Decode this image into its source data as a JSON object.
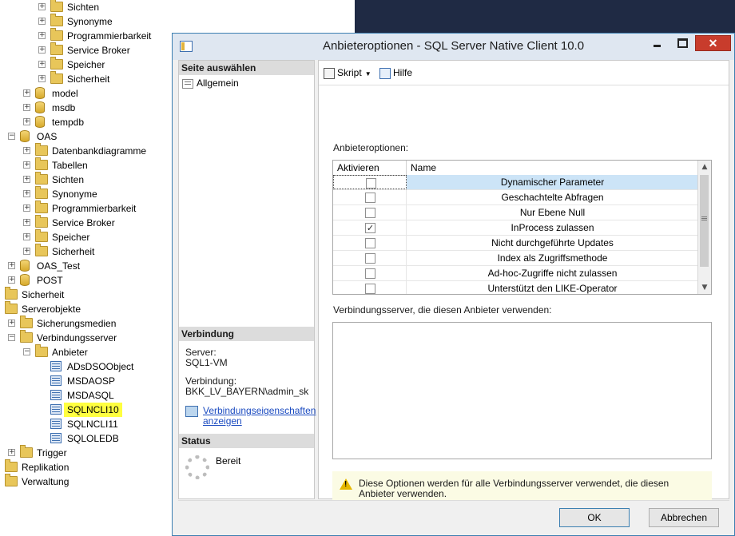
{
  "tree": {
    "items": [
      {
        "label": "Sichten",
        "icon": "folder-icon",
        "expander": "+"
      },
      {
        "label": "Synonyme",
        "icon": "folder-icon",
        "expander": "+"
      },
      {
        "label": "Programmierbarkeit",
        "icon": "folder-icon",
        "expander": "+"
      },
      {
        "label": "Service Broker",
        "icon": "folder-icon",
        "expander": "+"
      },
      {
        "label": "Speicher",
        "icon": "folder-icon",
        "expander": "+"
      },
      {
        "label": "Sicherheit",
        "icon": "folder-icon",
        "expander": "+"
      },
      {
        "label": "model",
        "icon": "database-icon",
        "expander": "+"
      },
      {
        "label": "msdb",
        "icon": "database-icon",
        "expander": "+"
      },
      {
        "label": "tempdb",
        "icon": "database-icon",
        "expander": "+"
      },
      {
        "label": "OAS",
        "icon": "database-icon",
        "expander": "−"
      },
      {
        "label": "Datenbankdiagramme",
        "icon": "folder-icon",
        "expander": "+"
      },
      {
        "label": "Tabellen",
        "icon": "folder-icon",
        "expander": "+"
      },
      {
        "label": "Sichten",
        "icon": "folder-icon",
        "expander": "+"
      },
      {
        "label": "Synonyme",
        "icon": "folder-icon",
        "expander": "+"
      },
      {
        "label": "Programmierbarkeit",
        "icon": "folder-icon",
        "expander": "+"
      },
      {
        "label": "Service Broker",
        "icon": "folder-icon",
        "expander": "+"
      },
      {
        "label": "Speicher",
        "icon": "folder-icon",
        "expander": "+"
      },
      {
        "label": "Sicherheit",
        "icon": "folder-icon",
        "expander": "+"
      },
      {
        "label": "OAS_Test",
        "icon": "database-icon",
        "expander": "+"
      },
      {
        "label": "POST",
        "icon": "database-icon",
        "expander": "+"
      },
      {
        "label": "Sicherheit",
        "icon": "folder-icon",
        "expander": ""
      },
      {
        "label": "Serverobjekte",
        "icon": "folder-icon",
        "expander": ""
      },
      {
        "label": "Sicherungsmedien",
        "icon": "folder-icon",
        "expander": "+"
      },
      {
        "label": "Verbindungsserver",
        "icon": "folder-icon",
        "expander": "−"
      },
      {
        "label": "Anbieter",
        "icon": "folder-icon",
        "expander": "−"
      },
      {
        "label": "ADsDSOObject",
        "icon": "provider-icon",
        "expander": ""
      },
      {
        "label": "MSDAOSP",
        "icon": "provider-icon",
        "expander": ""
      },
      {
        "label": "MSDASQL",
        "icon": "provider-icon",
        "expander": ""
      },
      {
        "label": "SQLNCLI10",
        "icon": "provider-icon",
        "expander": "",
        "highlighted": true
      },
      {
        "label": "SQLNCLI11",
        "icon": "provider-icon",
        "expander": ""
      },
      {
        "label": "SQLOLEDB",
        "icon": "provider-icon",
        "expander": ""
      },
      {
        "label": "Trigger",
        "icon": "folder-icon",
        "expander": "+"
      },
      {
        "label": "Replikation",
        "icon": "folder-icon",
        "expander": ""
      },
      {
        "label": "Verwaltung",
        "icon": "folder-icon",
        "expander": ""
      }
    ]
  },
  "dialog": {
    "title": "Anbieteroptionen - SQL Server Native Client 10.0",
    "left": {
      "select_page_header": "Seite auswählen",
      "page_general": "Allgemein",
      "connection_header": "Verbindung",
      "server_label": "Server:",
      "server_value": "SQL1-VM",
      "connection_label": "Verbindung:",
      "connection_value": "BKK_LV_BAYERN\\admin_sk",
      "connection_props_link_1": "Verbindungseigenschaften",
      "connection_props_link_2": "anzeigen",
      "status_header": "Status",
      "status_value": "Bereit"
    },
    "toolbar": {
      "script_label": "Skript",
      "help_label": "Hilfe"
    },
    "options_label": "Anbieteroptionen:",
    "grid": {
      "col_enable": "Aktivieren",
      "col_name": "Name",
      "rows": [
        {
          "name": "Dynamischer Parameter",
          "checked": false,
          "selected": true
        },
        {
          "name": "Geschachtelte Abfragen",
          "checked": false
        },
        {
          "name": "Nur Ebene Null",
          "checked": false
        },
        {
          "name": "InProcess zulassen",
          "checked": true
        },
        {
          "name": "Nicht durchgeführte Updates",
          "checked": false
        },
        {
          "name": "Index als Zugriffsmethode",
          "checked": false
        },
        {
          "name": "Ad-hoc-Zugriffe nicht zulassen",
          "checked": false
        },
        {
          "name": "Unterstützt den LIKE-Operator",
          "checked": false
        }
      ]
    },
    "servers_label": "Verbindungsserver, die diesen Anbieter verwenden:",
    "info_text": "Diese Optionen werden für alle Verbindungsserver verwendet, die diesen Anbieter verwenden.",
    "ok_label": "OK",
    "cancel_label": "Abbrechen"
  }
}
